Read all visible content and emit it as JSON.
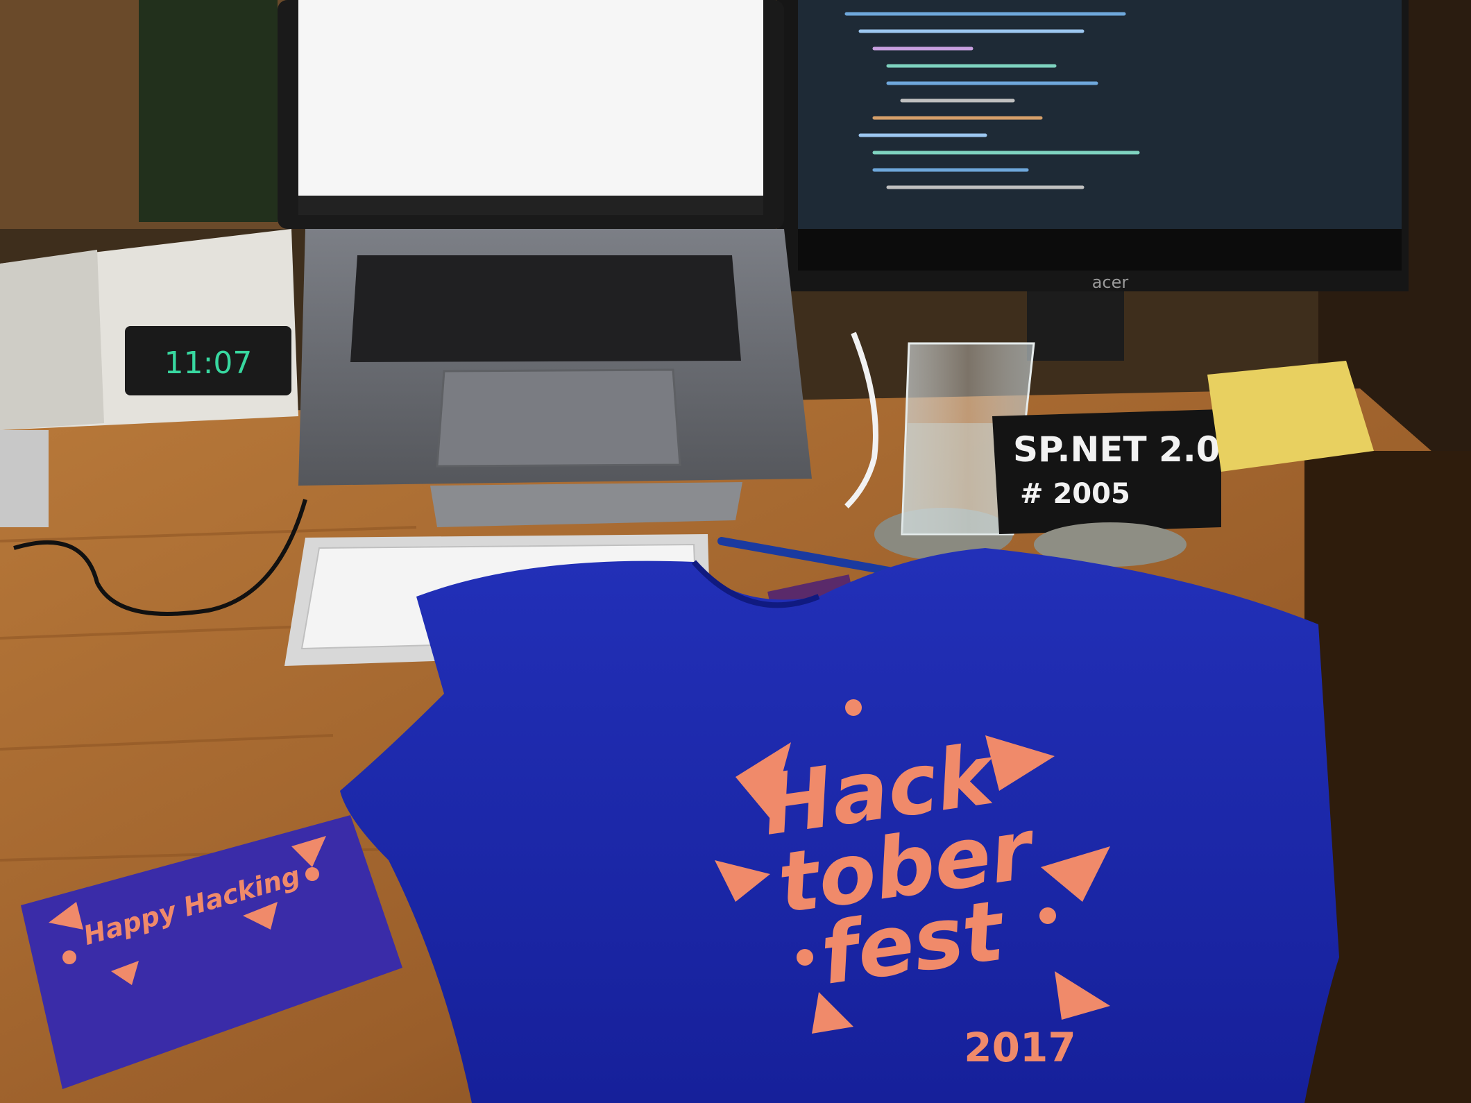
{
  "photo": {
    "subject": "Hacktoberfest 2017 t-shirt and envelope on a desk",
    "colors": {
      "desk": "#a8692f",
      "desk_dark": "#7a4a20",
      "wall": "#4a3a22",
      "shirt": "#1e28a8",
      "print": "#f08a6a",
      "envelope": "#3a2ca8",
      "laptop": "#6f7176",
      "screen_code": "#1e2a36",
      "clock_led": "#38d8a0"
    }
  },
  "clock": {
    "display": "11:07"
  },
  "book": {
    "line1": "SP.NET 2.0",
    "line2": "# 2005"
  },
  "monitor": {
    "brand": "acer"
  },
  "shirt": {
    "word1": "Hack",
    "word2": "tober",
    "word3": "fest",
    "year": "2017"
  },
  "envelope": {
    "text": "Happy Hacking"
  }
}
